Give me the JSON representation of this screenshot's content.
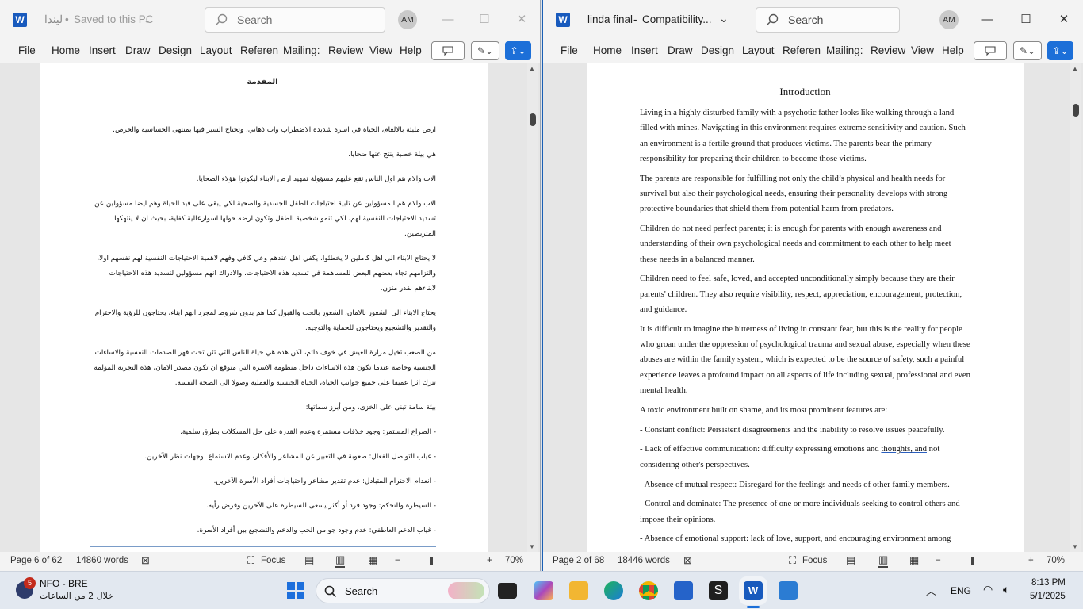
{
  "left_window": {
    "title_app": "W",
    "doc_name": "ليندا",
    "save_state": "Saved to this PC",
    "search_placeholder": "Search",
    "avatar": "AM",
    "menu": [
      "File",
      "Home",
      "Insert",
      "Draw",
      "Design",
      "Layout",
      "Referen",
      "Mailing:",
      "Review",
      "View",
      "Help"
    ],
    "document": {
      "heading": "المقدمة",
      "paragraphs": [
        "ارض مليئة بالالغام، الحياة في اسرة شديدة الاضطراب واب ذهاني، وتحتاج السير فيها بمنتهى الحساسية والحرص.",
        "هي بيئة خصبة ينتج عنها ضحايا.",
        "الاب والام هم اول الناس تقع عليهم مسؤولة تمهيد ارض الابناء ليكونوا هؤلاء الضحايا.",
        "الاب والام هم المسؤولين عن تلبية احتياجات الطفل الجسدية والصحية لكي يبقى على قيد الحياة وهم ايضا مسؤولين عن تسديد الاحتياجات النفسية لهم، لكي تنمو شخصية الطفل وتكون ارضه حولها اسوارعالية كفاية، بحيث ان لا ينتهكها المتربصين.",
        "لا يحتاج الابناء الى اهل كاملين لا يخطئوا، يكفي اهل عندهم وعي كافي وفهم لاهمية الاحتياجات النفسية لهم نفسهم اولا، والتزامهم تجاه بعضهم البعض للمساهمة في تسديد هذه الاحتياجات، والادراك انهم مسؤولين لتسديد هذه الاحتياجات لابناءهم بقدر متزن.",
        "يحتاج الابناء الى الشعور بالامان، الشعور بالحب والقبول كما هم بدون شروط لمجرد انهم ابناء، يحتاجون للرؤية والاحترام والتقدير والتشجيع ويحتاجون للحماية والتوجيه.",
        "من الصعب تخيل مرارة العيش في خوف دائم، لكن هذه هي حياة الناس التي تئن تحت قهر الصدمات النفسية والاساءات الجنسية وخاصة عندما تكون هذه الاساءات داخل منظومة الاسرة التي متوقع ان تكون مصدر الامان، هذه التجربة المؤلمة تترك اثرا عميقا على جميع جوانب الحياة، الحياة الجنسية والعملية وصولا الى الصحة النفسة.",
        "بيئة سامة تبنى على الخزى، ومن أبرز سماتها:",
        "- الصراع المستمر: وجود خلافات مستمرة وعدم القدرة على حل المشكلات بطرق سلمية.",
        "- غياب التواصل الفعال: صعوبة في التعبير عن المشاعر والأفكار، وعدم الاستماع لوجهات نظر الآخرين.",
        "- انعدام الاحترام المتبادل: عدم تقدير مشاعر واحتياجات أفراد الأسرة الآخرين.",
        "- السيطرة والتحكم: وجود فرد أو أكثر يسعى للسيطرة على الآخرين وفرض رأيه.",
        "- غياب الدعم العاطفي: عدم وجود جو من الحب والدعم والتشجيع بين أفراد الأسرة."
      ]
    },
    "status": {
      "page": "Page 6 of 62",
      "words": "14860 words",
      "focus": "Focus",
      "zoom": "70%"
    }
  },
  "right_window": {
    "title_app": "W",
    "doc_name": "linda final",
    "mode": "Compatibility...",
    "search_placeholder": "Search",
    "avatar": "AM",
    "menu": [
      "File",
      "Home",
      "Insert",
      "Draw",
      "Design",
      "Layout",
      "Referen",
      "Mailing:",
      "Review",
      "View",
      "Help"
    ],
    "document": {
      "heading": "Introduction",
      "paragraphs": [
        "Living in a highly disturbed family with a psychotic father looks like walking through a land filled with mines. Navigating in this environment requires extreme sensitivity and caution. Such an environment is a fertile ground that produces victims. The parents bear the primary responsibility for preparing their children to become those victims.",
        "The parents are responsible for fulfilling not only the child’s physical and health needs for survival but also their psychological needs, ensuring their personality develops with strong protective boundaries that shield them from potential harm from predators.",
        " Children do not need perfect parents; it is enough for parents with enough awareness and understanding of their own psychological needs and commitment to each other to help meet these needs in a balanced manner.",
        "Children need to feel safe, loved, and accepted unconditionally simply because they are their parents' children. They also require visibility, respect, appreciation, encouragement, protection, and guidance.",
        " It is difficult to imagine the bitterness of living in constant fear, but this is the reality for people who groan under the oppression of psychological trauma and sexual abuse, especially when these abuses are within the family system, which is expected to be the source of safety, such a painful experience leaves a profound impact on all aspects of life including sexual, professional and even mental health.",
        "A toxic environment built on shame, and its most prominent features are:",
        " - Constant conflict: Persistent disagreements and the inability to resolve issues peacefully."
      ],
      "p8_before": " - Lack of effective communication: difficulty expressing emotions and ",
      "p8_spell": "thoughts, and",
      "p8_after": " not considering other's perspectives.",
      "paragraphs_tail": [
        " - Absence of mutual respect: Disregard for the feelings and needs of other family members.",
        " - Control and dominate: The presence of one or more individuals seeking to control others and impose their opinions.",
        " - Absence of emotional support: lack of love, support, and encouraging environment among"
      ]
    },
    "status": {
      "page": "Page 2 of 68",
      "words": "18446 words",
      "focus": "Focus",
      "zoom": "70%"
    }
  },
  "taskbar": {
    "news_badge": "5",
    "news_title": "NFO - BRE",
    "news_sub": "خلال 2 من الساعات",
    "search_label": "Search",
    "lang": "ENG",
    "time": "8:13 PM",
    "date": "5/1/2025"
  },
  "colors": {
    "word_blue": "#185abd",
    "accent": "#1c6fd8",
    "window_bg": "#f3f3f3",
    "taskbar_bg": "#e2e8f0"
  }
}
